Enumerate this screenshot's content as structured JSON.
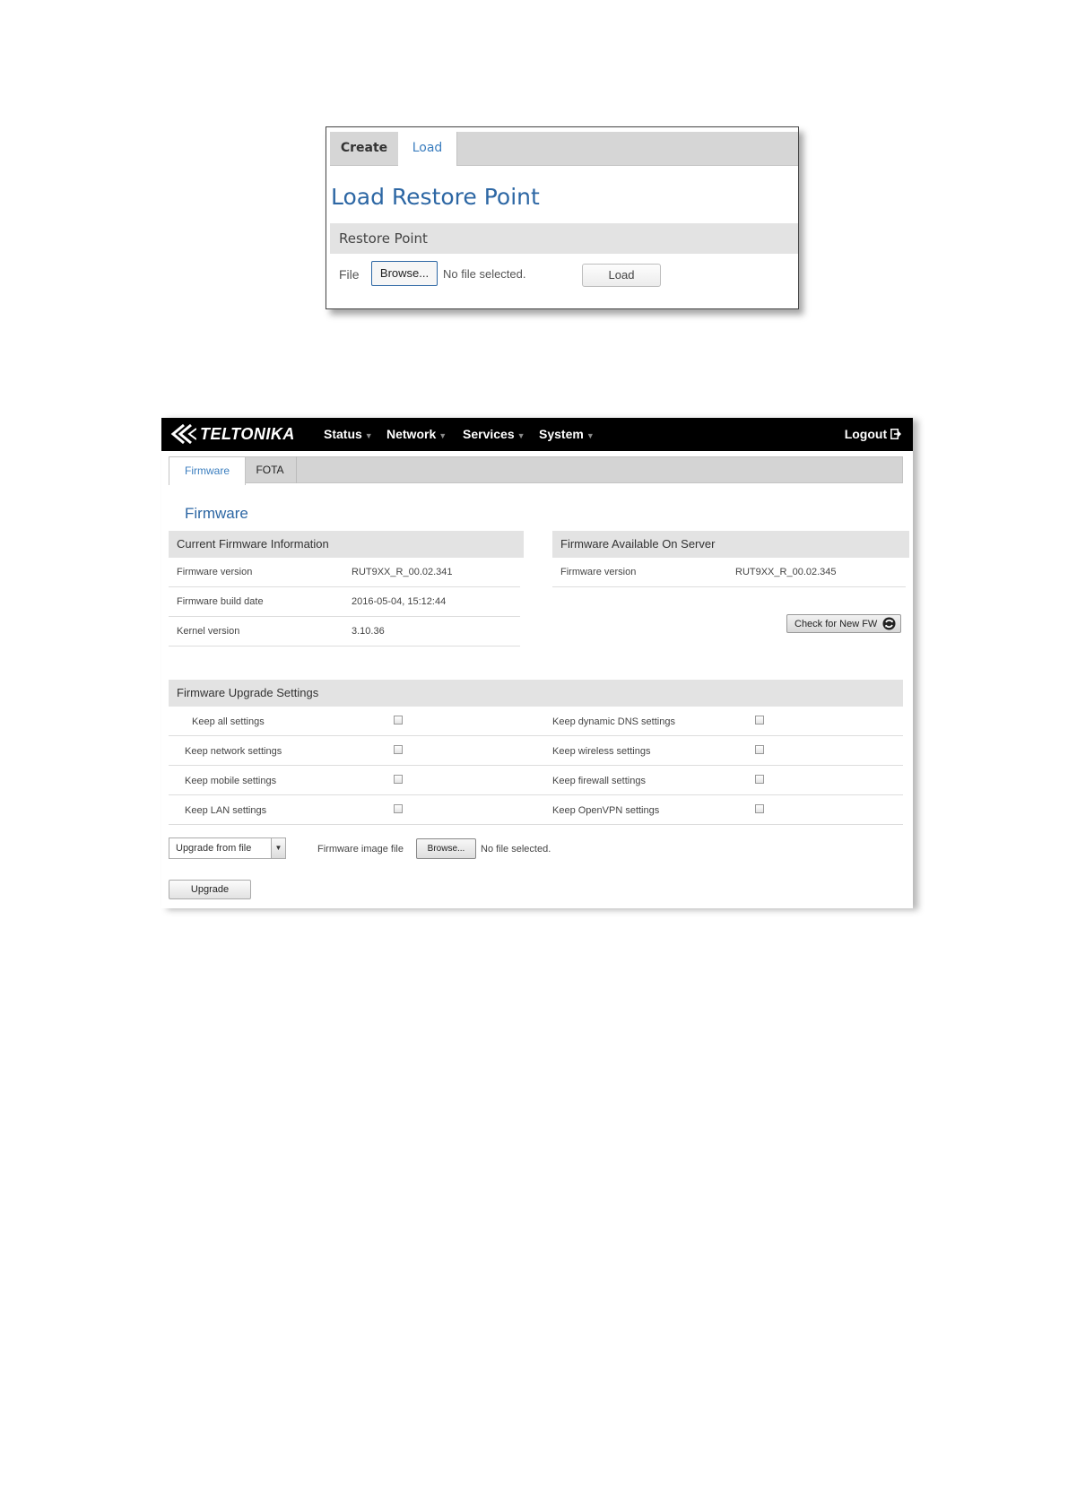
{
  "restore": {
    "tabs": [
      {
        "label": "Create"
      },
      {
        "label": "Load"
      }
    ],
    "title": "Load Restore Point",
    "section_title": "Restore Point",
    "file_label": "File",
    "browse_label": "Browse...",
    "no_file_text": "No file selected.",
    "load_button": "Load"
  },
  "firmware_page": {
    "brand": "TELTONIKA",
    "nav": [
      {
        "label": "Status"
      },
      {
        "label": "Network"
      },
      {
        "label": "Services"
      },
      {
        "label": "System"
      }
    ],
    "logout": "Logout",
    "tabs": [
      {
        "label": "Firmware"
      },
      {
        "label": "FOTA"
      }
    ],
    "title": "Firmware",
    "current": {
      "header": "Current Firmware Information",
      "rows": [
        {
          "label": "Firmware version",
          "value": "RUT9XX_R_00.02.341"
        },
        {
          "label": "Firmware build date",
          "value": "2016-05-04, 15:12:44"
        },
        {
          "label": "Kernel version",
          "value": "3.10.36"
        }
      ]
    },
    "server": {
      "header": "Firmware Available On Server",
      "rows": [
        {
          "label": "Firmware version",
          "value": "RUT9XX_R_00.02.345"
        }
      ],
      "check_button": "Check for New FW"
    },
    "upgrade_settings": {
      "header": "Firmware Upgrade Settings",
      "left": [
        {
          "label": "Keep all settings",
          "checked": false
        },
        {
          "label": "Keep network settings",
          "checked": false
        },
        {
          "label": "Keep mobile settings",
          "checked": false
        },
        {
          "label": "Keep LAN settings",
          "checked": false
        }
      ],
      "right": [
        {
          "label": "Keep dynamic DNS settings",
          "checked": false
        },
        {
          "label": "Keep wireless settings",
          "checked": false
        },
        {
          "label": "Keep firewall settings",
          "checked": false
        },
        {
          "label": "Keep OpenVPN settings",
          "checked": false
        }
      ]
    },
    "upgrade_method": "Upgrade from file",
    "image_file_label": "Firmware image file",
    "browse_label": "Browse...",
    "no_file_text": "No file selected.",
    "upgrade_button": "Upgrade"
  }
}
